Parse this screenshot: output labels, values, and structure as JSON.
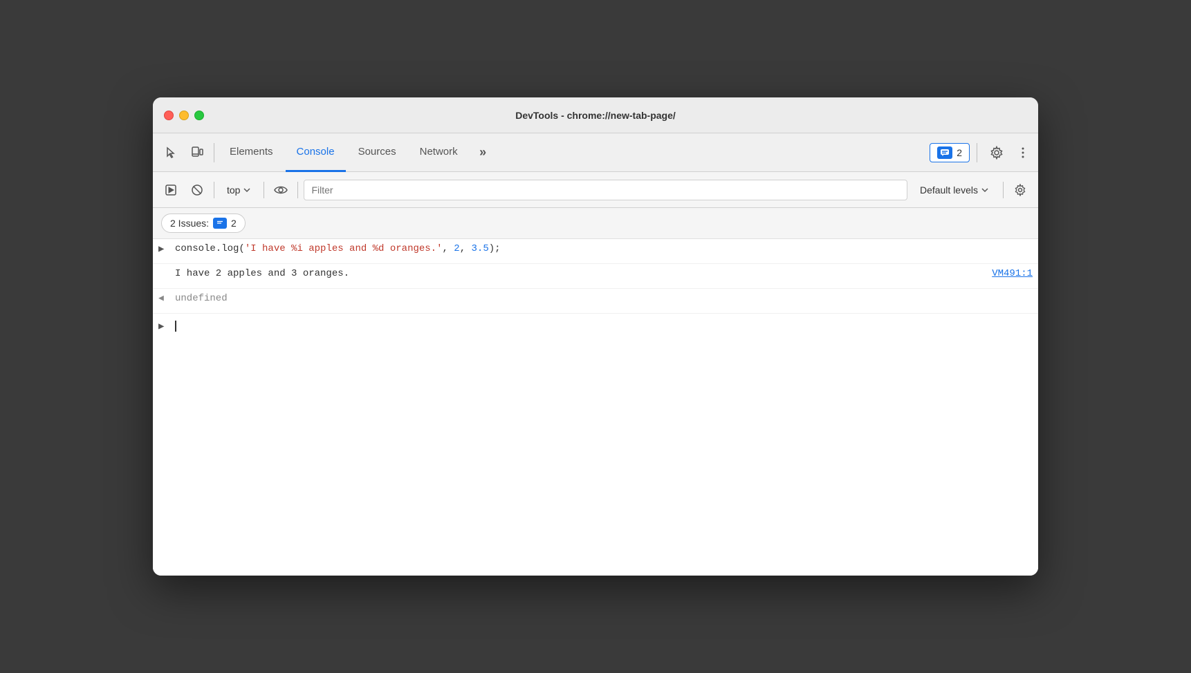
{
  "window": {
    "title": "DevTools - chrome://new-tab-page/"
  },
  "tabbar": {
    "inspect_label": "Inspect",
    "device_label": "Device",
    "tabs": [
      {
        "id": "elements",
        "label": "Elements",
        "active": false
      },
      {
        "id": "console",
        "label": "Console",
        "active": true
      },
      {
        "id": "sources",
        "label": "Sources",
        "active": false
      },
      {
        "id": "network",
        "label": "Network",
        "active": false
      }
    ],
    "more_label": "»",
    "issues_label": "2",
    "issues_count": "2",
    "gear_label": "⚙",
    "dots_label": "⋮"
  },
  "console_toolbar": {
    "top_label": "top",
    "filter_placeholder": "Filter",
    "default_levels_label": "Default levels"
  },
  "issues_bar": {
    "label": "2 Issues:",
    "count": "2"
  },
  "console": {
    "lines": [
      {
        "type": "log",
        "code_parts": [
          {
            "text": "console.log(",
            "class": "code-plain"
          },
          {
            "text": "'I have %i apples and %d oranges.'",
            "class": "code-string"
          },
          {
            "text": ", ",
            "class": "code-plain"
          },
          {
            "text": "2",
            "class": "code-number"
          },
          {
            "text": ", ",
            "class": "code-plain"
          },
          {
            "text": "3.5",
            "class": "code-number"
          },
          {
            "text": ");",
            "class": "code-plain"
          }
        ]
      },
      {
        "type": "output",
        "text": "I have 2 apples and 3 oranges.",
        "source": "VM491:1"
      },
      {
        "type": "return",
        "text": "undefined"
      }
    ]
  },
  "colors": {
    "active_tab": "#1a73e8",
    "close": "#ff5f57",
    "minimize": "#febc2e",
    "maximize": "#28c840"
  }
}
